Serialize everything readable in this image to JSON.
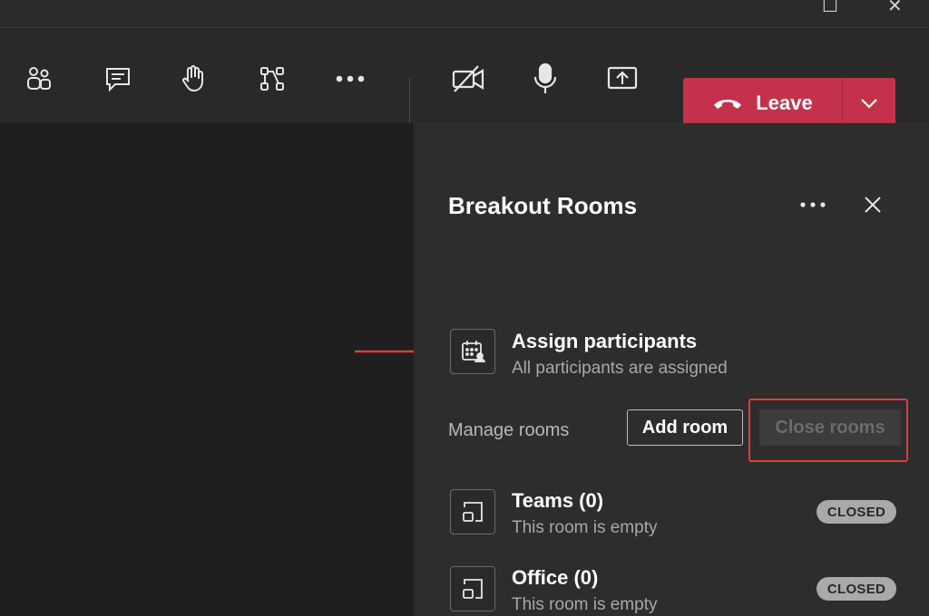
{
  "icons": {
    "participants": "people-icon",
    "chat": "chat-icon",
    "raise_hand": "raise-hand-icon",
    "breakout": "breakout-rooms-icon",
    "more": "more-icon",
    "camera_off": "camera-off-icon",
    "mic": "microphone-icon",
    "share": "share-screen-icon"
  },
  "leave": {
    "label": "Leave",
    "color": "#c4314b"
  },
  "panel": {
    "title": "Breakout Rooms",
    "assign": {
      "title": "Assign participants",
      "subtitle": "All participants are assigned"
    },
    "manage_label": "Manage rooms",
    "add_room_label": "Add room",
    "close_rooms_label": "Close rooms",
    "rooms": [
      {
        "name": "Teams (0)",
        "status": "This room is empty",
        "badge": "CLOSED"
      },
      {
        "name": "Office (0)",
        "status": "This room is empty",
        "badge": "CLOSED"
      }
    ]
  },
  "highlight_color": "#e23b3b"
}
